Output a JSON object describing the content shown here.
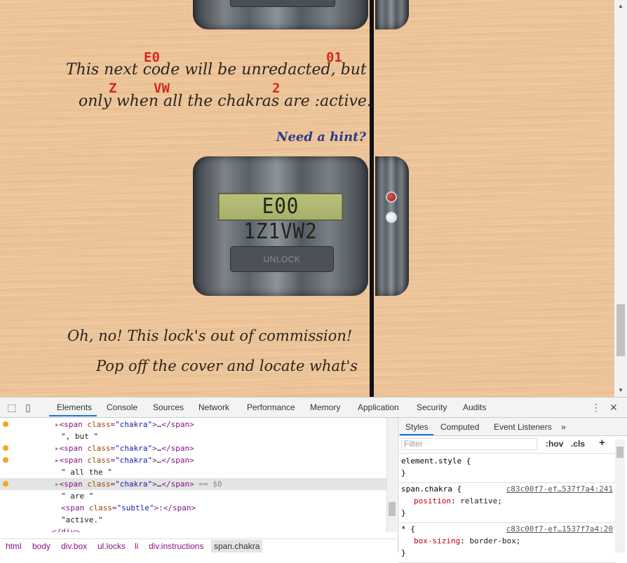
{
  "page": {
    "note_line1": "This next code will be unredacted, but",
    "note_line2": "only when all the chakras are :active.",
    "hint_link": "Need a hint?",
    "red_tags": [
      "E0",
      "01",
      "Z",
      "VW",
      "2"
    ],
    "lcd_display": "E00 1Z1VW2",
    "unlock_label": "UNLOCK",
    "note_line3": "Oh, no! This lock's out of commission!",
    "note_line4": "Pop off the cover and locate what's",
    "colors": {
      "red_tag": "#d02a1f",
      "hint": "#2b3a8c",
      "led_red": "#c0392b",
      "led_cyan": "#bfe9ee"
    }
  },
  "devtools": {
    "tabs": [
      "Elements",
      "Console",
      "Sources",
      "Network",
      "Performance",
      "Memory",
      "Application",
      "Security",
      "Audits"
    ],
    "active_tab": "Elements",
    "elements_rows": [
      {
        "tag": "span",
        "cls": "chakra",
        "suffix": "",
        "dot": true,
        "arrow": true
      },
      {
        "text": "\", but \""
      },
      {
        "tag": "span",
        "cls": "chakra",
        "suffix": "",
        "dot": true,
        "arrow": true
      },
      {
        "tag": "span",
        "cls": "chakra",
        "suffix": "",
        "dot": true,
        "arrow": true
      },
      {
        "text": "\" all the \""
      },
      {
        "tag": "span",
        "cls": "chakra",
        "suffix": "== $0",
        "dot": true,
        "arrow": true,
        "selected": true
      },
      {
        "text": "\" are \""
      },
      {
        "tag": "span",
        "cls": "subtle",
        "inner": ":",
        "arrow": false
      },
      {
        "text": "\"active.\""
      },
      {
        "close": "</div>"
      }
    ],
    "breadcrumbs": [
      "html",
      "body",
      "div.box",
      "ul.locks",
      "li",
      "div.instructions",
      "span.chakra"
    ],
    "styles_tabs": [
      "Styles",
      "Computed",
      "Event Listeners",
      "»"
    ],
    "filter_placeholder": "Filter",
    "filter_buttons": [
      ":hov",
      ".cls",
      "+"
    ],
    "rules": [
      {
        "selector": "element.style {",
        "close": "}",
        "source": "",
        "props": []
      },
      {
        "selector": "span.chakra {",
        "close": "}",
        "source": "c83c00f7-ef…537f7a4:241",
        "props": [
          {
            "name": "position",
            "value": "relative;"
          }
        ]
      },
      {
        "selector": "* {",
        "close": "}",
        "source": "c83c00f7-ef…1537f7a4:20",
        "props": [
          {
            "name": "box-sizing",
            "value": "border-box;"
          }
        ]
      }
    ]
  }
}
